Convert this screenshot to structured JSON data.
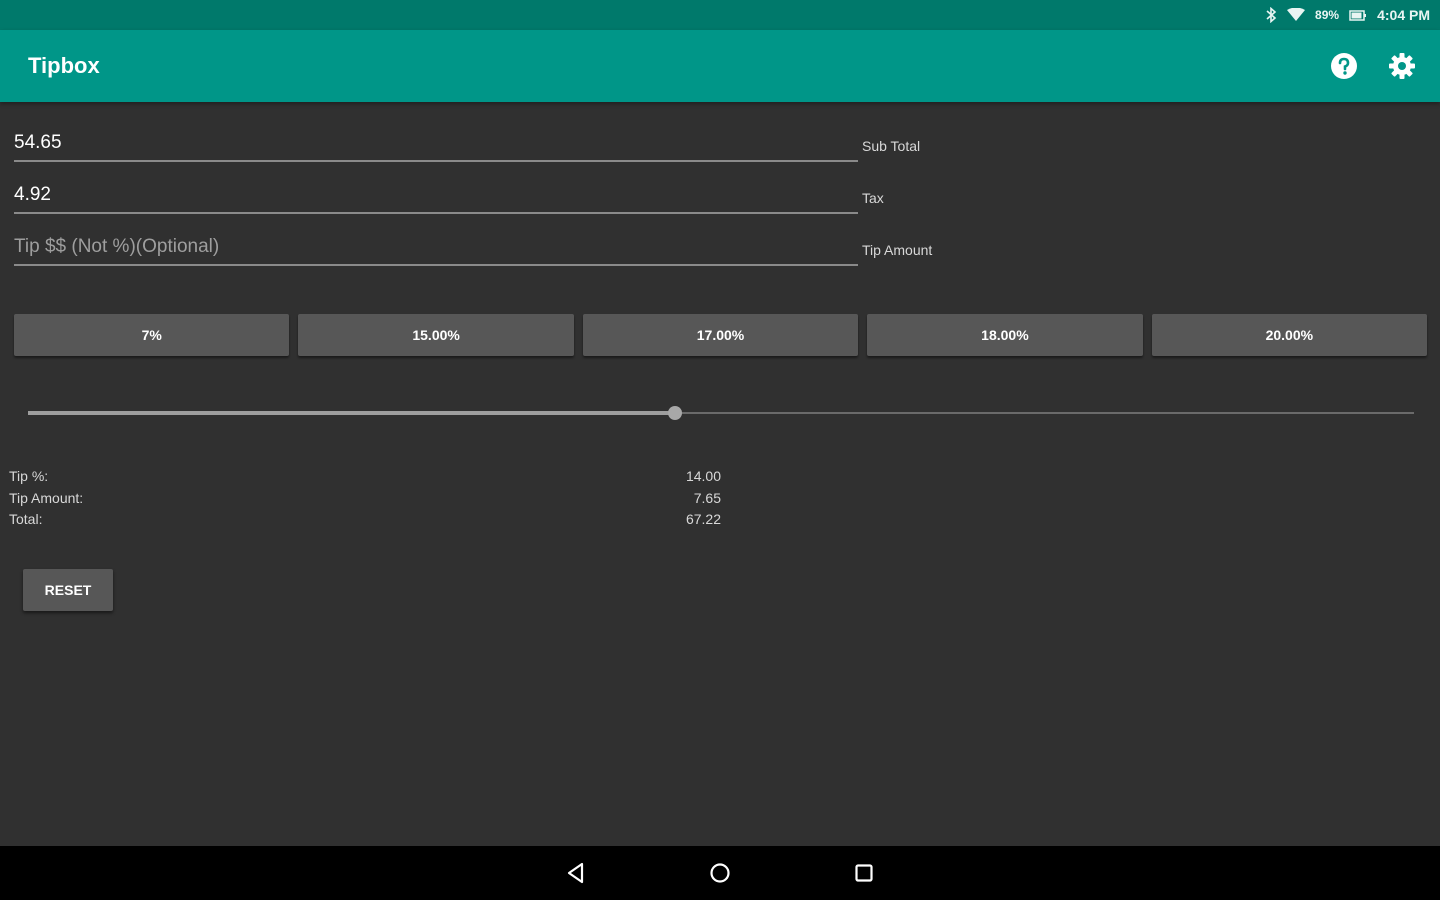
{
  "status_bar": {
    "battery_text": "89%",
    "time": "4:04 PM",
    "icons": [
      "bluetooth-icon",
      "wifi-icon",
      "battery-icon"
    ]
  },
  "app_bar": {
    "title": "Tipbox",
    "actions": [
      "help-icon",
      "settings-icon"
    ]
  },
  "form": {
    "subtotal": {
      "value": "54.65",
      "label": "Sub Total"
    },
    "tax": {
      "value": "4.92",
      "label": "Tax"
    },
    "tip_amount": {
      "value": "",
      "placeholder": "Tip $$ (Not %)(Optional)",
      "label": "Tip Amount"
    }
  },
  "presets": [
    "7%",
    "15.00%",
    "17.00%",
    "18.00%",
    "20.00%"
  ],
  "slider": {
    "fraction": 0.467
  },
  "results": {
    "tip_percent": {
      "label": "Tip %:",
      "value": "14.00"
    },
    "tip_amount": {
      "label": "Tip Amount:",
      "value": "7.65"
    },
    "total": {
      "label": "Total:",
      "value": "67.22"
    }
  },
  "reset_label": "RESET",
  "nav_bar": {
    "icons": [
      "back-icon",
      "home-icon",
      "recents-icon"
    ]
  },
  "colors": {
    "status_bar": "#00796b",
    "app_bar": "#009688",
    "background": "#303030",
    "button": "#575757"
  }
}
